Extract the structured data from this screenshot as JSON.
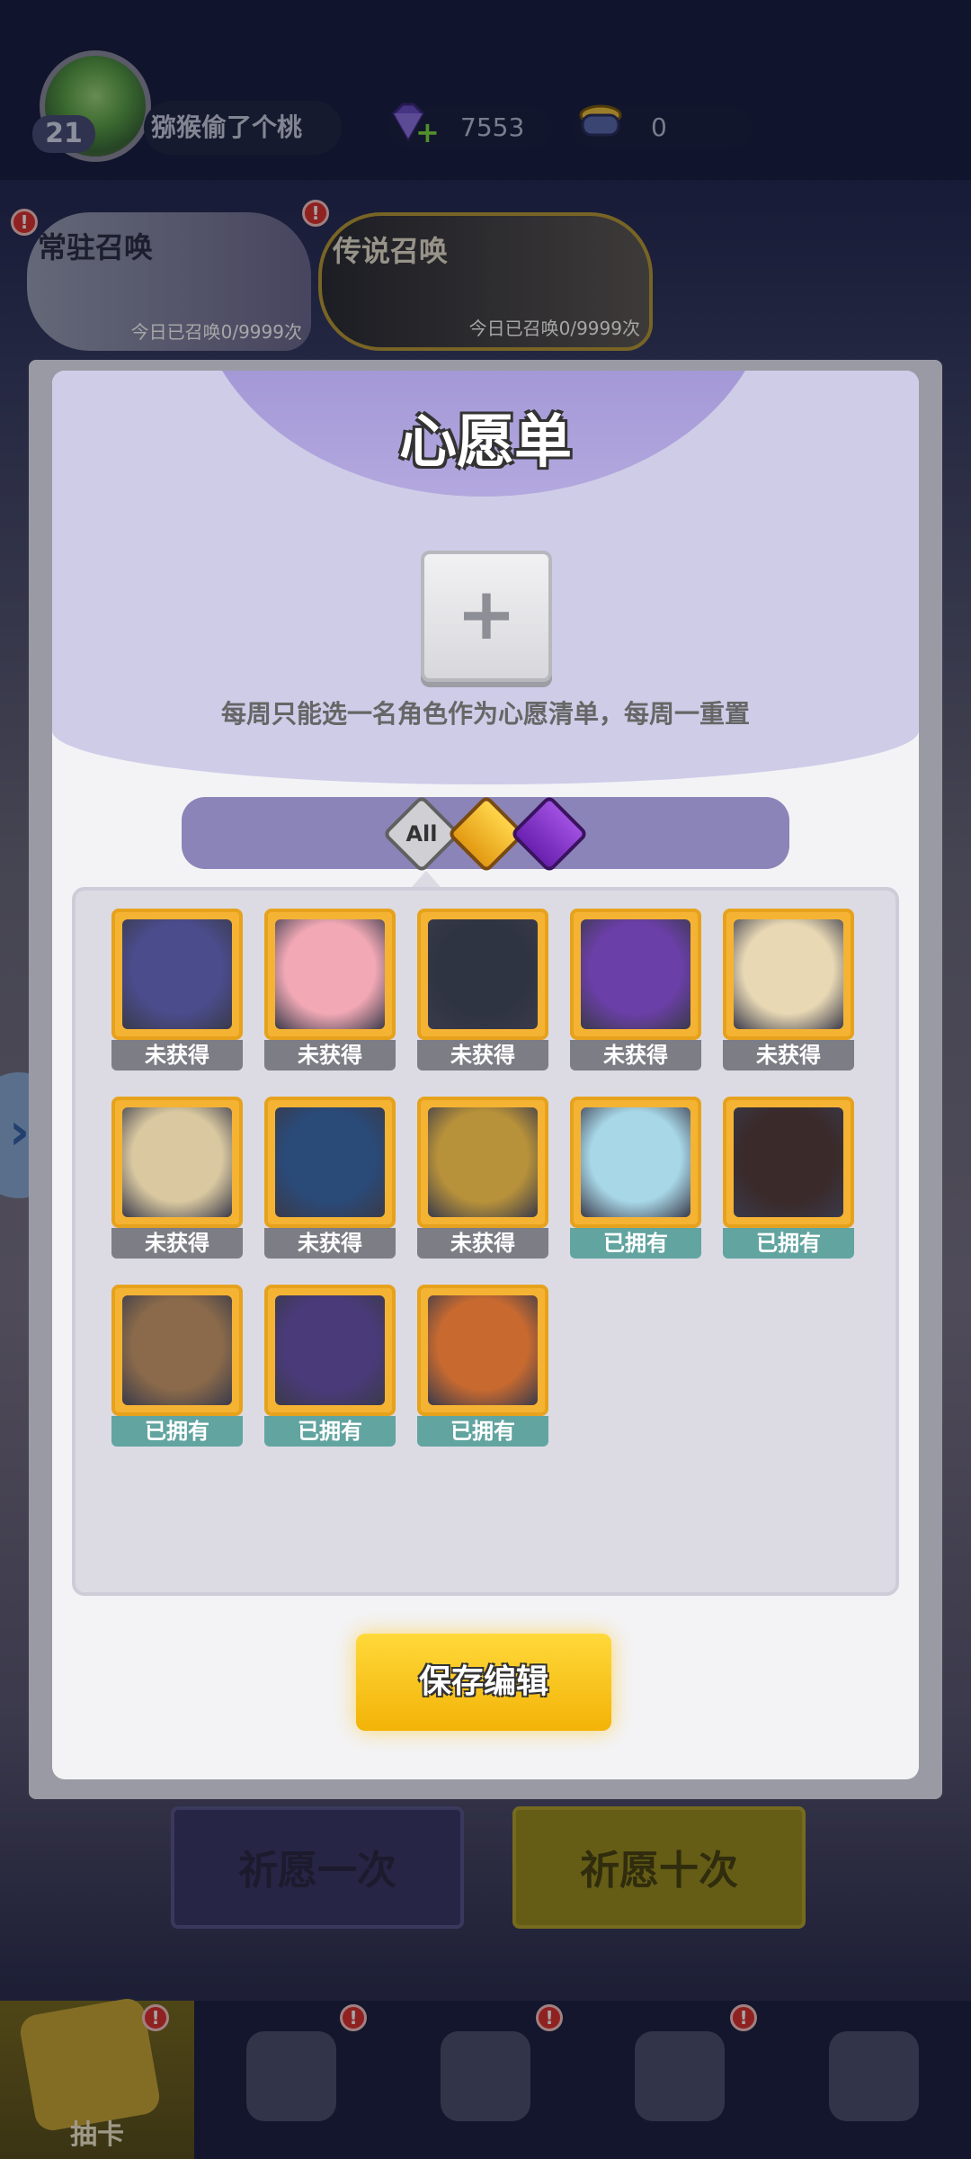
{
  "player": {
    "level": "21",
    "name": "猕猴偷了个桃"
  },
  "currency": {
    "gems": "7553",
    "coins": "0"
  },
  "banners": [
    {
      "title": "常驻召唤",
      "subtitle": "今日已召唤0/9999次"
    },
    {
      "title": "传说召唤",
      "subtitle": "今日已召唤0/9999次"
    }
  ],
  "alert_glyph": "!",
  "modal": {
    "title": "心愿单",
    "add_glyph": "+",
    "description": "每周只能选一名角色作为心愿清单，每周一重置",
    "filters": {
      "all_label": "All",
      "light_icon": "light-element-icon",
      "dark_icon": "dark-element-icon"
    },
    "save_label": "保存编辑"
  },
  "heroes": [
    {
      "status": "未获得",
      "owned": false,
      "color": "#4a4c8c"
    },
    {
      "status": "未获得",
      "owned": false,
      "color": "#f2a9b5"
    },
    {
      "status": "未获得",
      "owned": false,
      "color": "#2f3442"
    },
    {
      "status": "未获得",
      "owned": false,
      "color": "#6b3fa8"
    },
    {
      "status": "未获得",
      "owned": false,
      "color": "#e8d8b4"
    },
    {
      "status": "未获得",
      "owned": false,
      "color": "#d9c8a0"
    },
    {
      "status": "未获得",
      "owned": false,
      "color": "#2a4a78"
    },
    {
      "status": "未获得",
      "owned": false,
      "color": "#b8923a"
    },
    {
      "status": "已拥有",
      "owned": true,
      "color": "#a8d8e8"
    },
    {
      "status": "已拥有",
      "owned": true,
      "color": "#3a2a2a"
    },
    {
      "status": "已拥有",
      "owned": true,
      "color": "#8a6a4a"
    },
    {
      "status": "已拥有",
      "owned": true,
      "color": "#4a3a7a"
    },
    {
      "status": "已拥有",
      "owned": true,
      "color": "#c86a30"
    }
  ],
  "background": {
    "pray_once": "祈愿一次",
    "pray_ten": "祈愿十次"
  },
  "nav": {
    "draw_label": "抽卡"
  }
}
